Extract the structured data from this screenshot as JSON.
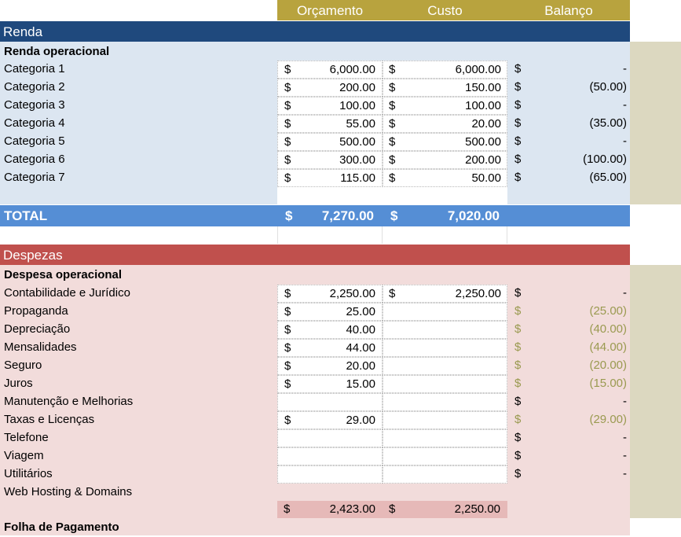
{
  "header": {
    "col_budget": "Orçamento",
    "col_cost": "Custo",
    "col_balance": "Balanço"
  },
  "income": {
    "title": "Renda",
    "subheading": "Renda operacional",
    "rows": [
      {
        "label": "Categoria 1",
        "budget": "6,000.00",
        "cost": "6,000.00",
        "balance": "-"
      },
      {
        "label": "Categoria 2",
        "budget": "200.00",
        "cost": "150.00",
        "balance": "(50.00)"
      },
      {
        "label": "Categoria 3",
        "budget": "100.00",
        "cost": "100.00",
        "balance": "-"
      },
      {
        "label": "Categoria 4",
        "budget": "55.00",
        "cost": "20.00",
        "balance": "(35.00)"
      },
      {
        "label": "Categoria 5",
        "budget": "500.00",
        "cost": "500.00",
        "balance": "-"
      },
      {
        "label": "Categoria 6",
        "budget": "300.00",
        "cost": "200.00",
        "balance": "(100.00)"
      },
      {
        "label": "Categoria 7",
        "budget": "115.00",
        "cost": "50.00",
        "balance": "(65.00)"
      }
    ],
    "total_label": "TOTAL",
    "total_budget": "7,270.00",
    "total_cost": "7,020.00"
  },
  "currency": "$",
  "expenses": {
    "title": "Despezas",
    "subheading": "Despesa operacional",
    "rows": [
      {
        "label": "Contabilidade e Jurídico",
        "budget": "2,250.00",
        "cost": "2,250.00",
        "balance": "-",
        "gold": false
      },
      {
        "label": "Propaganda",
        "budget": "25.00",
        "cost": "",
        "balance": "(25.00)",
        "gold": true
      },
      {
        "label": "Depreciação",
        "budget": "40.00",
        "cost": "",
        "balance": "(40.00)",
        "gold": true
      },
      {
        "label": "Mensalidades",
        "budget": "44.00",
        "cost": "",
        "balance": "(44.00)",
        "gold": true
      },
      {
        "label": "Seguro",
        "budget": "20.00",
        "cost": "",
        "balance": "(20.00)",
        "gold": true
      },
      {
        "label": "Juros",
        "budget": "15.00",
        "cost": "",
        "balance": "(15.00)",
        "gold": true
      },
      {
        "label": "Manutenção e Melhorias",
        "budget": "",
        "cost": "",
        "balance": "-",
        "gold": false
      },
      {
        "label": "Taxas e Licenças",
        "budget": "29.00",
        "cost": "",
        "balance": "(29.00)",
        "gold": true
      },
      {
        "label": "Telefone",
        "budget": "",
        "cost": "",
        "balance": "-",
        "gold": false
      },
      {
        "label": "Viagem",
        "budget": "",
        "cost": "",
        "balance": "-",
        "gold": false
      },
      {
        "label": "Utilitários",
        "budget": "",
        "cost": "",
        "balance": "-",
        "gold": false
      },
      {
        "label": "Web Hosting & Domains",
        "budget": "",
        "cost": "",
        "balance": "",
        "gold": false
      }
    ],
    "subtotal_budget": "2,423.00",
    "subtotal_cost": "2,250.00",
    "payroll_heading": "Folha de Pagamento"
  },
  "colors": {
    "header_gold": "#b8a33e",
    "income_blue": "#1f497d",
    "total_blue": "#558ed5",
    "expense_red": "#c0504d",
    "subtotal_pink": "#e6b9b8"
  }
}
